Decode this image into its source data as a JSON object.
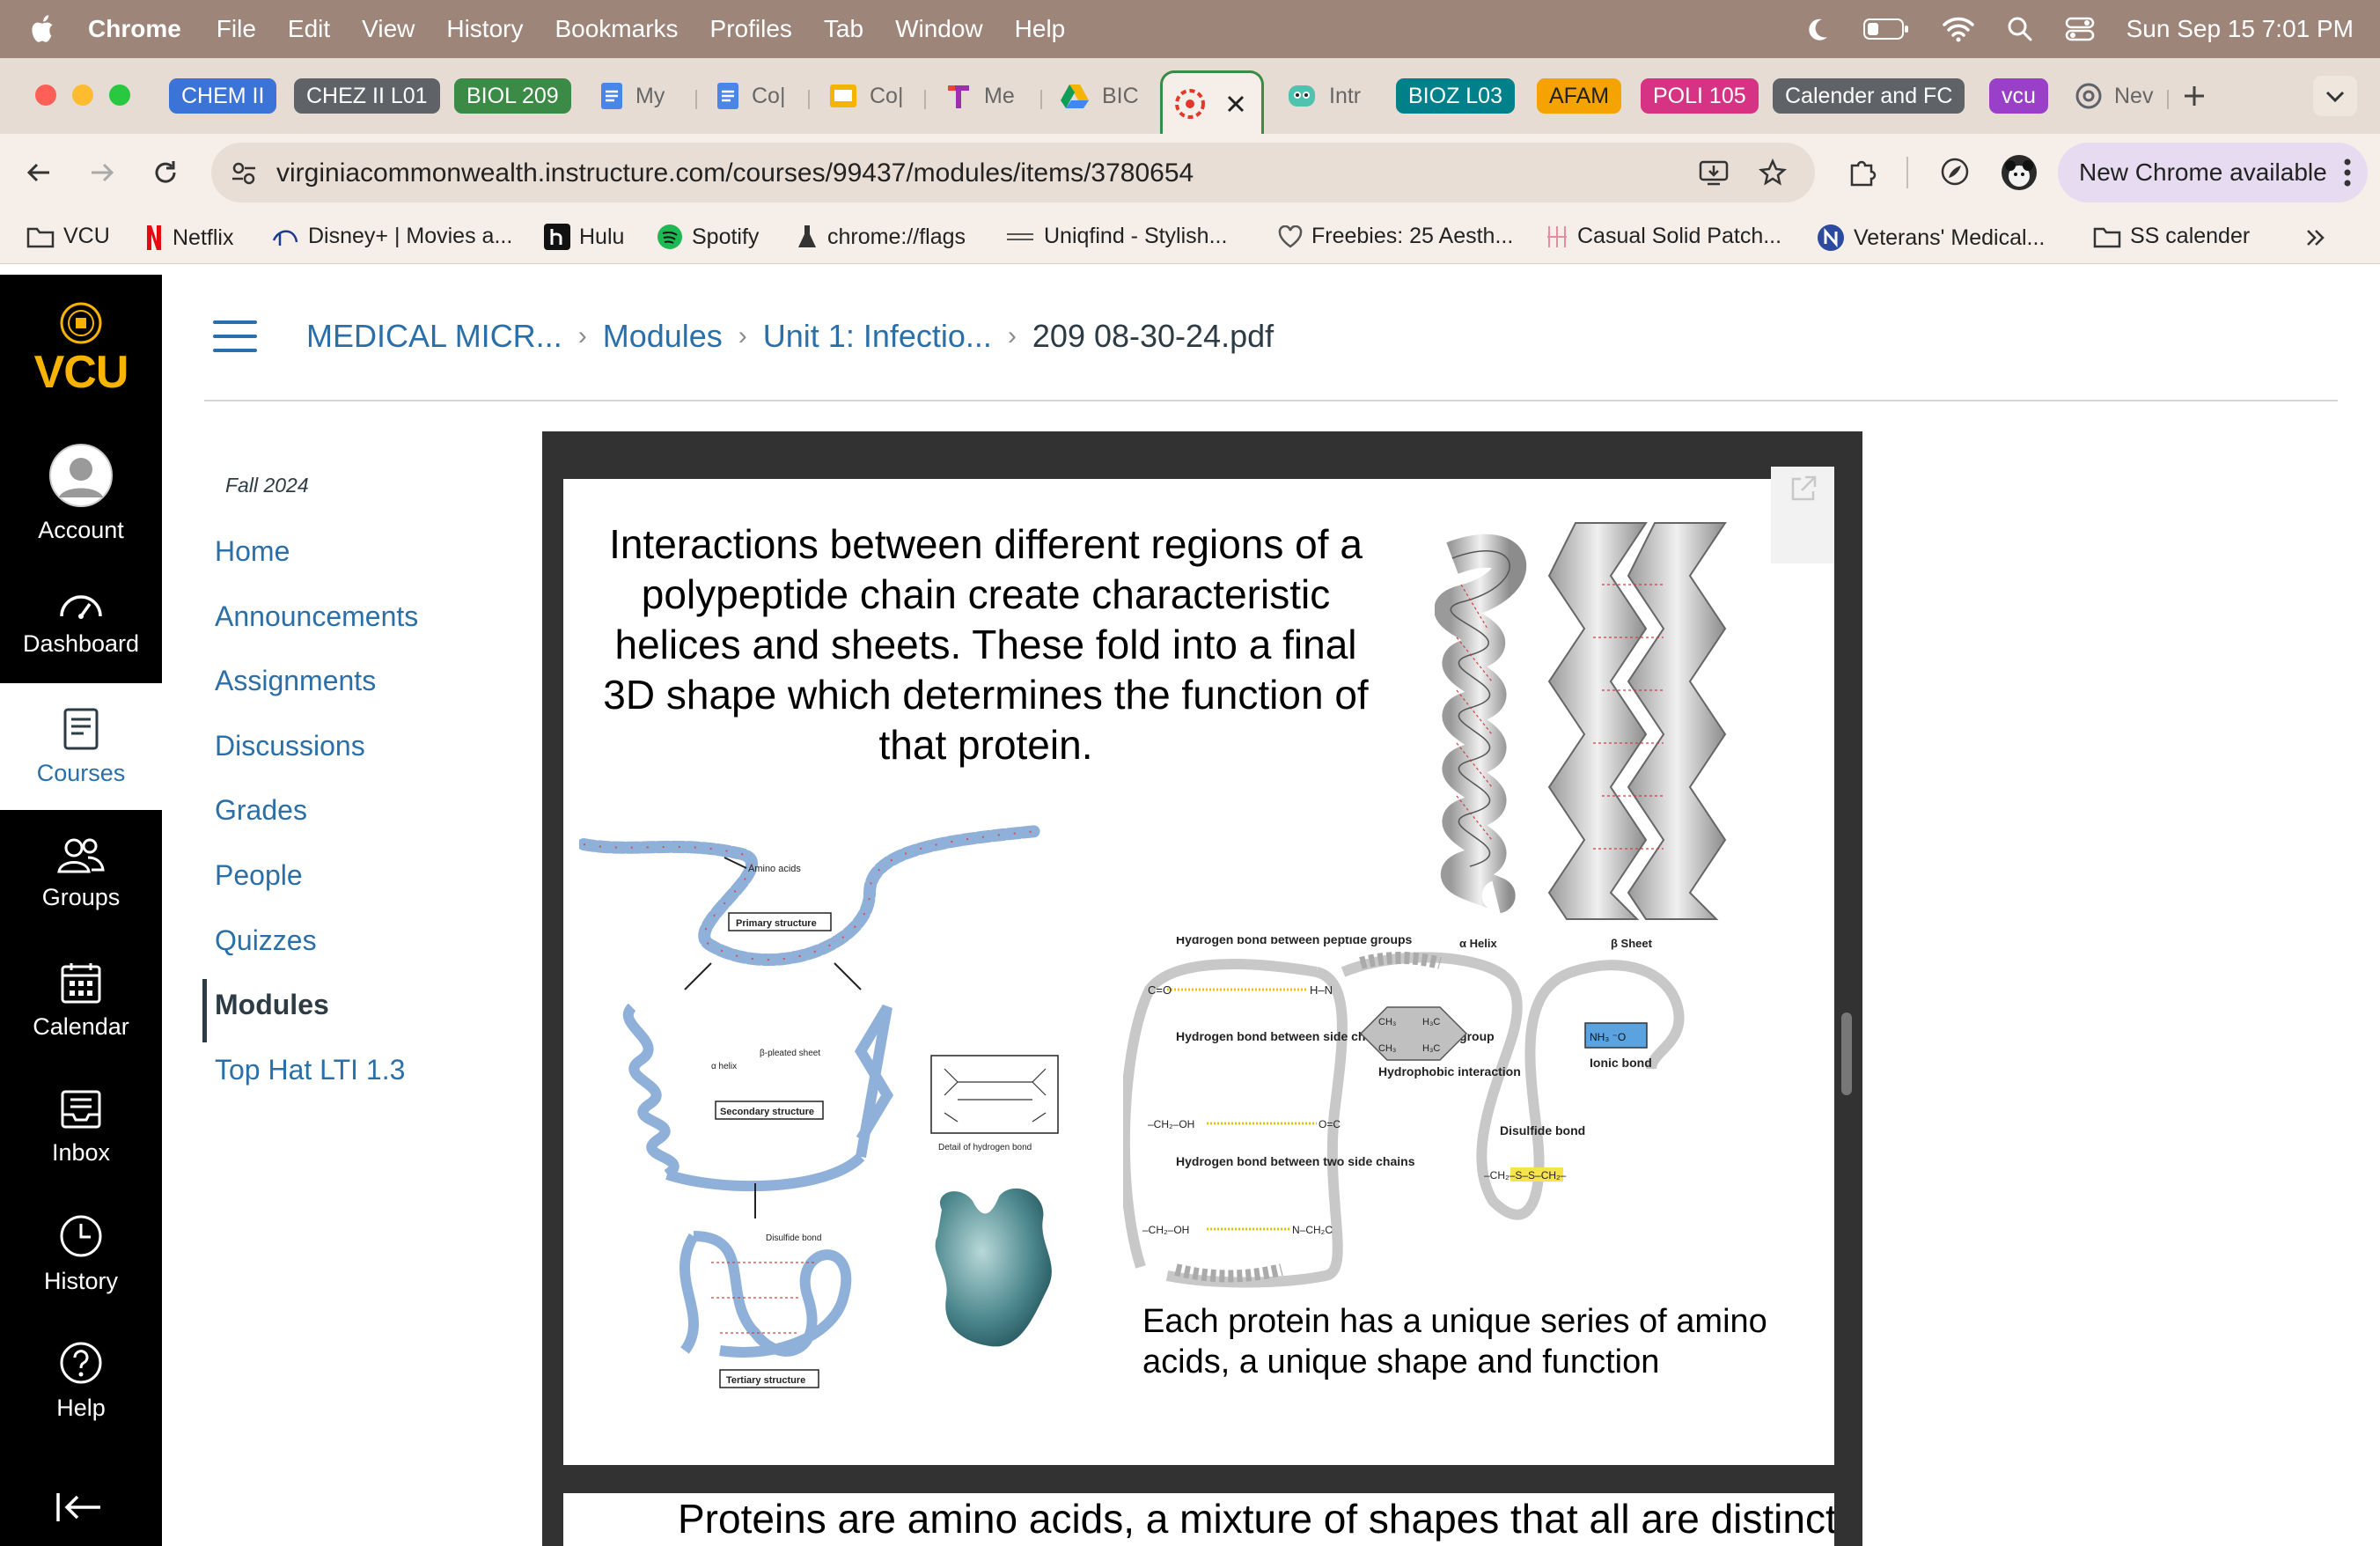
{
  "menubar": {
    "app_name": "Chrome",
    "items": [
      "File",
      "Edit",
      "View",
      "History",
      "Bookmarks",
      "Profiles",
      "Tab",
      "Window",
      "Help"
    ],
    "clock": "Sun Sep 15  7:01 PM"
  },
  "tabs": {
    "items": [
      {
        "label": "CHEM II",
        "kind": "group",
        "color": "#3b73d6"
      },
      {
        "label": "CHEZ II L01",
        "kind": "group",
        "color": "#5f6368"
      },
      {
        "label": "BIOL 209",
        "kind": "group",
        "color": "#3b8a45"
      },
      {
        "label": "My",
        "kind": "tab",
        "icon": "docs-icon"
      },
      {
        "label": "Co|",
        "kind": "tab",
        "icon": "docs-icon"
      },
      {
        "label": "Co|",
        "kind": "tab",
        "icon": "slides-icon"
      },
      {
        "label": "Me",
        "kind": "tab",
        "icon": "t-logo-icon"
      },
      {
        "label": "BIC",
        "kind": "tab",
        "icon": "drive-icon"
      },
      {
        "label": "Intr",
        "kind": "tab",
        "icon": "mascot-icon"
      },
      {
        "label": "BIOZ L03",
        "kind": "group",
        "color": "#00808a"
      },
      {
        "label": "AFAM",
        "kind": "group",
        "color": "#f4a300"
      },
      {
        "label": "POLI 105",
        "kind": "group",
        "color": "#d63384"
      },
      {
        "label": "Calender and FC",
        "kind": "group",
        "color": "#5f6368"
      },
      {
        "label": "vcu",
        "kind": "group",
        "color": "#9a3fc7"
      },
      {
        "label": "Nev",
        "kind": "tab",
        "icon": "chrome-icon"
      }
    ]
  },
  "toolbar": {
    "url": "virginiacommonwealth.instructure.com/courses/99437/modules/items/3780654",
    "update_label": "New Chrome available"
  },
  "bookmarks": [
    "VCU",
    "Netflix",
    "Disney+ | Movies a...",
    "Hulu",
    "Spotify",
    "chrome://flags",
    "Uniqfind - Stylish...",
    "Freebies: 25 Aesth...",
    "Casual Solid Patch...",
    "Veterans' Medical...",
    "SS calender"
  ],
  "global_nav": {
    "logo": "VCU",
    "items": [
      "Account",
      "Dashboard",
      "Courses",
      "Groups",
      "Calendar",
      "Inbox",
      "History",
      "Help"
    ]
  },
  "breadcrumb": [
    "MEDICAL MICR...",
    "Modules",
    "Unit 1: Infectio...",
    "209 08-30-24.pdf"
  ],
  "course_nav": {
    "term": "Fall 2024",
    "items": [
      "Home",
      "Announcements",
      "Assignments",
      "Discussions",
      "Grades",
      "People",
      "Quizzes",
      "Modules",
      "Top Hat LTI 1.3"
    ],
    "active": "Modules"
  },
  "slide": {
    "title": "Interactions between different regions of a polypeptide chain create characteristic helices and sheets.  These fold into a final 3D shape which determines the function of that protein.",
    "caption": "Each protein has a unique series of amino acids, a unique shape and function",
    "labels": {
      "amino_acids": "Amino acids",
      "primary": "Primary structure",
      "alpha_helix_small": "α helix",
      "beta_sheet_small": "β-pleated sheet",
      "secondary": "Secondary structure",
      "hbond_detail": "Detail of hydrogen bond",
      "disulfide_small": "Disulfide bond",
      "tertiary": "Tertiary structure",
      "alpha_helix": "α Helix",
      "beta_sheet": "β Sheet",
      "hb_peptide": "Hydrogen bond between peptide groups",
      "hb_side_peptide": "Hydrogen bond between side chain and peptide group",
      "hb_two_side": "Hydrogen bond between two side chains",
      "hydrophobic": "Hydrophobic interaction",
      "disulfide": "Disulfide bond",
      "ionic": "Ionic bond"
    },
    "page2_partial": "Proteins are amino acids, a mixture of shapes that all are distinct"
  }
}
